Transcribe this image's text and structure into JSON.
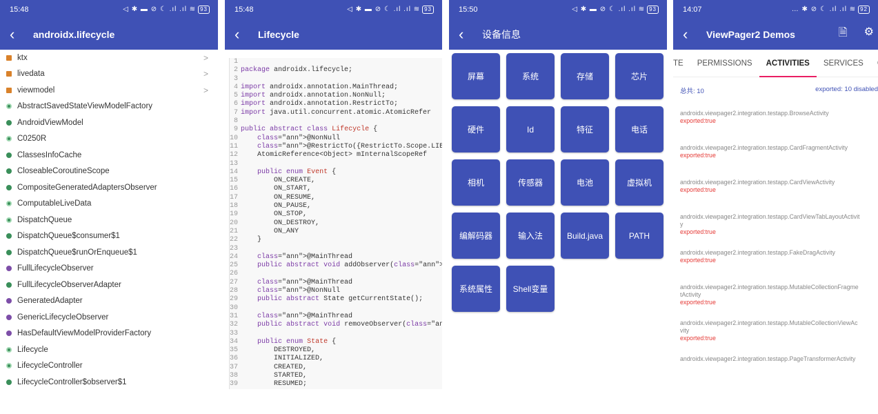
{
  "screen1": {
    "status_time": "15:48",
    "status_icons": "◁ ✱ ▬ ⊘ ☾ .ıl .ıl ≋",
    "battery": "93",
    "title": "androidx.lifecycle",
    "items": [
      {
        "label": "ktx",
        "icon": "package-icon",
        "kind": "pkg",
        "chevron": ">"
      },
      {
        "label": "livedata",
        "icon": "package-icon",
        "kind": "pkg",
        "chevron": ">"
      },
      {
        "label": "viewmodel",
        "icon": "package-icon",
        "kind": "pkg",
        "chevron": ">"
      },
      {
        "label": "AbstractSavedStateViewModelFactory",
        "icon": "abstract-class-icon",
        "kind": "abstract"
      },
      {
        "label": "AndroidViewModel",
        "icon": "class-icon",
        "kind": "class"
      },
      {
        "label": "C0250R",
        "icon": "abstract-class-icon",
        "kind": "abstract"
      },
      {
        "label": "ClassesInfoCache",
        "icon": "class-icon",
        "kind": "class"
      },
      {
        "label": "CloseableCoroutineScope",
        "icon": "class-icon",
        "kind": "class"
      },
      {
        "label": "CompositeGeneratedAdaptersObserver",
        "icon": "class-icon",
        "kind": "class"
      },
      {
        "label": "ComputableLiveData",
        "icon": "abstract-class-icon",
        "kind": "abstract"
      },
      {
        "label": "DispatchQueue",
        "icon": "abstract-class-icon",
        "kind": "abstract"
      },
      {
        "label": "DispatchQueue$consumer$1",
        "icon": "class-icon",
        "kind": "class"
      },
      {
        "label": "DispatchQueue$runOrEnqueue$1",
        "icon": "class-icon",
        "kind": "class"
      },
      {
        "label": "FullLifecycleObserver",
        "icon": "interface-icon",
        "kind": "iface"
      },
      {
        "label": "FullLifecycleObserverAdapter",
        "icon": "class-icon",
        "kind": "class"
      },
      {
        "label": "GeneratedAdapter",
        "icon": "interface-icon",
        "kind": "iface"
      },
      {
        "label": "GenericLifecycleObserver",
        "icon": "interface-icon",
        "kind": "iface"
      },
      {
        "label": "HasDefaultViewModelProviderFactory",
        "icon": "interface-icon",
        "kind": "iface"
      },
      {
        "label": "Lifecycle",
        "icon": "abstract-class-icon",
        "kind": "abstract"
      },
      {
        "label": "LifecycleController",
        "icon": "abstract-class-icon",
        "kind": "abstract"
      },
      {
        "label": "LifecycleController$observer$1",
        "icon": "class-icon",
        "kind": "class"
      }
    ]
  },
  "screen2": {
    "status_time": "15:48",
    "status_icons": "◁ ✱ ▬ ⊘ ☾ .ıl .ıl ≋",
    "battery": "93",
    "title": "Lifecycle",
    "lines": [
      {
        "n": "1",
        "t": ""
      },
      {
        "n": "2",
        "t": "package androidx.lifecycle;"
      },
      {
        "n": "3",
        "t": ""
      },
      {
        "n": "4",
        "t": "import androidx.annotation.MainThread;"
      },
      {
        "n": "5",
        "t": "import androidx.annotation.NonNull;"
      },
      {
        "n": "6",
        "t": "import androidx.annotation.RestrictTo;"
      },
      {
        "n": "7",
        "t": "import java.util.concurrent.atomic.AtomicRefer"
      },
      {
        "n": "8",
        "t": ""
      },
      {
        "n": "9",
        "t": "public abstract class Lifecycle {"
      },
      {
        "n": "10",
        "t": "    @NonNull"
      },
      {
        "n": "11",
        "t": "    @RestrictTo({RestrictTo.Scope.LIBRARY_GROU"
      },
      {
        "n": "12",
        "t": "    AtomicReference<Object> mInternalScopeRef"
      },
      {
        "n": "13",
        "t": ""
      },
      {
        "n": "14",
        "t": "    public enum Event {"
      },
      {
        "n": "15",
        "t": "        ON_CREATE,"
      },
      {
        "n": "16",
        "t": "        ON_START,"
      },
      {
        "n": "17",
        "t": "        ON_RESUME,"
      },
      {
        "n": "18",
        "t": "        ON_PAUSE,"
      },
      {
        "n": "19",
        "t": "        ON_STOP,"
      },
      {
        "n": "20",
        "t": "        ON_DESTROY,"
      },
      {
        "n": "21",
        "t": "        ON_ANY"
      },
      {
        "n": "22",
        "t": "    }"
      },
      {
        "n": "23",
        "t": ""
      },
      {
        "n": "24",
        "t": "    @MainThread"
      },
      {
        "n": "25",
        "t": "    public abstract void addObserver(@NonNull"
      },
      {
        "n": "26",
        "t": ""
      },
      {
        "n": "27",
        "t": "    @MainThread"
      },
      {
        "n": "28",
        "t": "    @NonNull"
      },
      {
        "n": "29",
        "t": "    public abstract State getCurrentState();"
      },
      {
        "n": "30",
        "t": ""
      },
      {
        "n": "31",
        "t": "    @MainThread"
      },
      {
        "n": "32",
        "t": "    public abstract void removeObserver(@NonNu"
      },
      {
        "n": "33",
        "t": ""
      },
      {
        "n": "34",
        "t": "    public enum State {"
      },
      {
        "n": "35",
        "t": "        DESTROYED,"
      },
      {
        "n": "36",
        "t": "        INITIALIZED,"
      },
      {
        "n": "37",
        "t": "        CREATED,"
      },
      {
        "n": "38",
        "t": "        STARTED,"
      },
      {
        "n": "39",
        "t": "        RESUMED;"
      }
    ]
  },
  "screen3": {
    "status_time": "15:50",
    "status_icons": "◁ ✱ ▬ ⊘ ☾ .ıl .ıl ≋",
    "battery": "93",
    "title": "设备信息",
    "tiles": [
      "屏幕",
      "系统",
      "存储",
      "芯片",
      "硬件",
      "Id",
      "特征",
      "电话",
      "相机",
      "传感器",
      "电池",
      "虚拟机",
      "编解码器",
      "输入法",
      "Build.java",
      "PATH",
      "系统属性",
      "Shell变量"
    ]
  },
  "screen4": {
    "status_time": "14:07",
    "status_icons": "… ✱ ⊘ ☾ .ıl .ıl ≋",
    "battery": "92",
    "title": "ViewPager2 Demos",
    "tabs": [
      {
        "label": "TE",
        "active": false
      },
      {
        "label": "PERMISSIONS",
        "active": false
      },
      {
        "label": "ACTIVITIES",
        "active": true
      },
      {
        "label": "SERVICES",
        "active": false
      },
      {
        "label": "CON",
        "active": false
      }
    ],
    "total": "总共: 10",
    "exported_summary": "exported: 10  disabled",
    "activities": [
      {
        "name": "androidx.viewpager2.integration.testapp.BrowseActivity",
        "exported": "exported:true"
      },
      {
        "name": "androidx.viewpager2.integration.testapp.CardFragmentActivity",
        "exported": "exported:true"
      },
      {
        "name": "androidx.viewpager2.integration.testapp.CardViewActivity",
        "exported": "exported:true"
      },
      {
        "name": "androidx.viewpager2.integration.testapp.CardViewTabLayoutActivit\ny",
        "exported": "exported:true"
      },
      {
        "name": "androidx.viewpager2.integration.testapp.FakeDragActivity",
        "exported": "exported:true"
      },
      {
        "name": "androidx.viewpager2.integration.testapp.MutableCollectionFragme\ntActivity",
        "exported": "exported:true"
      },
      {
        "name": "androidx.viewpager2.integration.testapp.MutableCollectionViewAc\nvity",
        "exported": "exported:true"
      },
      {
        "name": "androidx.viewpager2.integration.testapp.PageTransformerActivity",
        "exported": ""
      }
    ]
  }
}
